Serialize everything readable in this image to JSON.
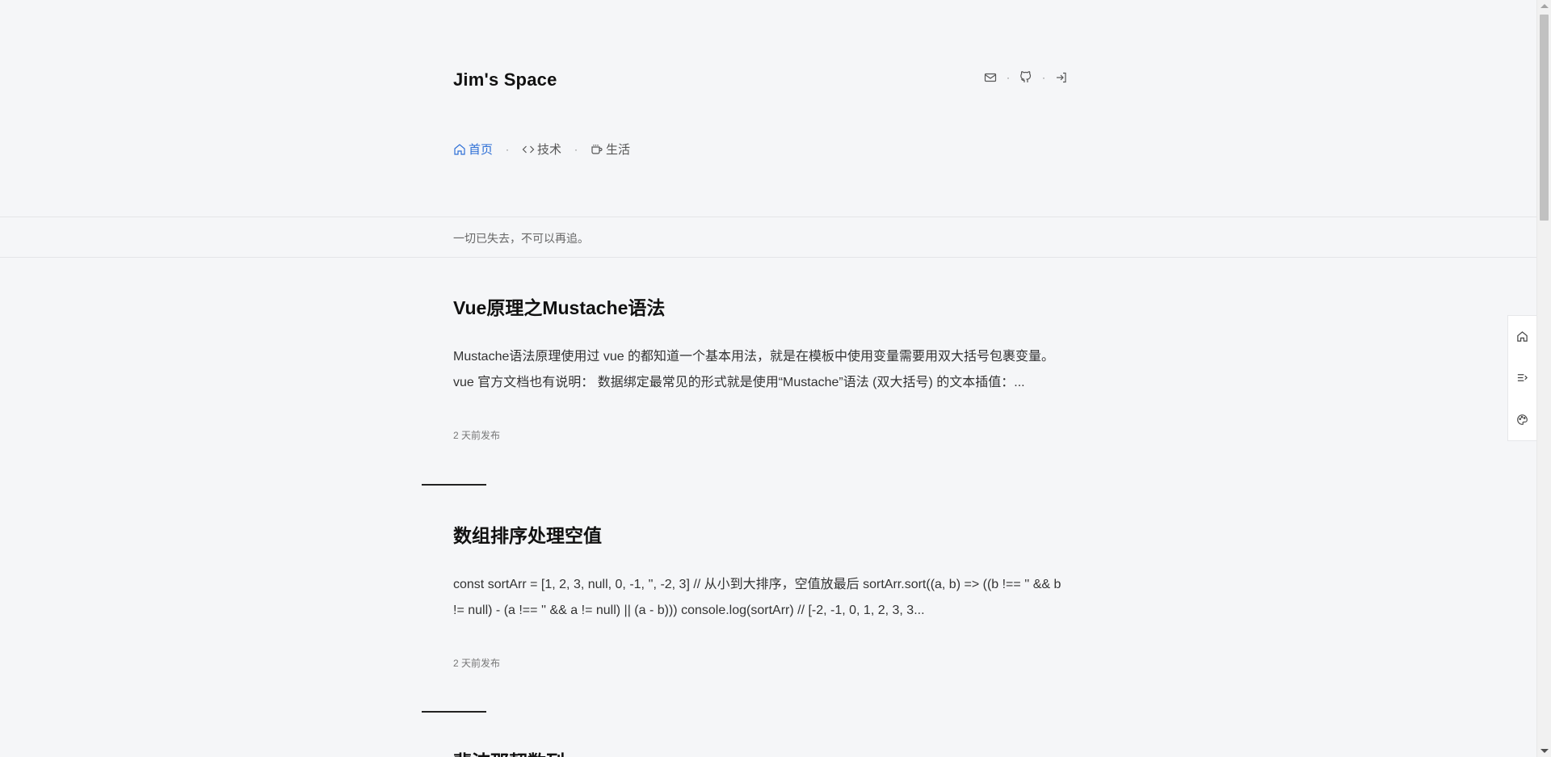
{
  "header": {
    "site_title": "Jim's Space",
    "icons": [
      "mail-icon",
      "github-icon",
      "login-icon"
    ],
    "separator": "·"
  },
  "nav": {
    "items": [
      {
        "label": "首页",
        "icon": "home-icon",
        "active": true
      },
      {
        "label": "技术",
        "icon": "code-icon",
        "active": false
      },
      {
        "label": "生活",
        "icon": "coffee-icon",
        "active": false
      }
    ],
    "separator": "·"
  },
  "tagline": "一切已失去，不可以再追。",
  "posts": [
    {
      "title": "Vue原理之Mustache语法",
      "excerpt": "Mustache语法原理使用过 vue 的都知道一个基本用法，就是在模板中使用变量需要用双大括号包裹变量。 vue 官方文档也有说明： 数据绑定最常见的形式就是使用“Mustache”语法 (双大括号) 的文本插值：...",
      "meta": "2 天前发布"
    },
    {
      "title": "数组排序处理空值",
      "excerpt": "const sortArr = [1, 2, 3, null, 0, -1, '', -2, 3] // 从小到大排序，空值放最后 sortArr.sort((a, b) => ((b !== '' && b != null) - (a !== '' && a != null) || (a - b))) console.log(sortArr) // [-2, -1, 0, 1, 2, 3, 3...",
      "meta": "2 天前发布"
    },
    {
      "title": "斐波那契数列",
      "excerpt": "",
      "meta": ""
    }
  ],
  "float_toolbar": [
    "home-icon",
    "toc-icon",
    "palette-icon"
  ],
  "colors": {
    "background": "#f5f6f8",
    "accent": "#2d6fd6",
    "text": "#222222"
  }
}
